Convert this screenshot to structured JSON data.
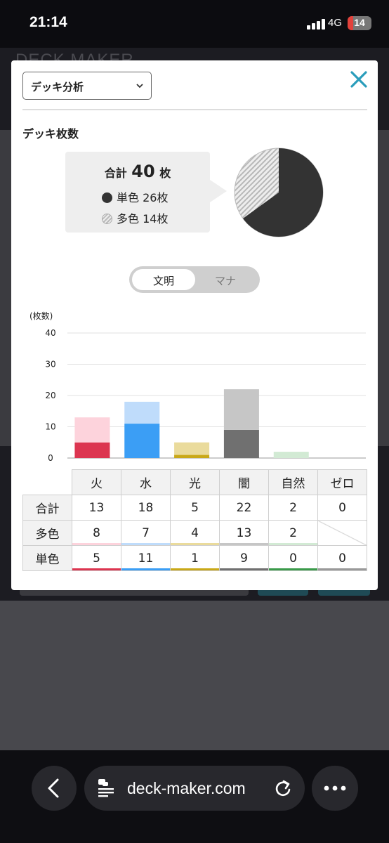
{
  "status": {
    "time": "21:14",
    "network": "4G",
    "battery": "14"
  },
  "background": {
    "app_logo": "DECK MAKER"
  },
  "modal": {
    "view_select": "デッキ分析",
    "section_title": "デッキ枚数",
    "summary": {
      "total_prefix": "合計",
      "total_value": "40",
      "total_unit": "枚",
      "mono_label": "単色 26枚",
      "multi_label": "多色 14枚",
      "mono_count": 26,
      "multi_count": 14,
      "mono_color": "#333333"
    },
    "toggle": {
      "active": "文明",
      "inactive": "マナ"
    },
    "table": {
      "columns": [
        "火",
        "水",
        "光",
        "闇",
        "自然",
        "ゼロ"
      ],
      "rows": [
        {
          "label": "合計",
          "values": [
            "13",
            "18",
            "5",
            "22",
            "2",
            "0"
          ]
        },
        {
          "label": "多色",
          "values": [
            "8",
            "7",
            "4",
            "13",
            "2",
            ""
          ]
        },
        {
          "label": "単色",
          "values": [
            "5",
            "11",
            "1",
            "9",
            "0",
            "0"
          ]
        }
      ]
    }
  },
  "chart_data": {
    "type": "bar",
    "stacked": true,
    "ylabel": "(枚数)",
    "ylim": [
      0,
      40
    ],
    "yticks": [
      "0",
      "10",
      "20",
      "30",
      "40"
    ],
    "grid": true,
    "categories": [
      "火",
      "水",
      "光",
      "闇",
      "自然",
      "ゼロ"
    ],
    "series": [
      {
        "values": [
          5,
          11,
          1,
          9,
          0,
          0
        ],
        "colors": [
          "#dc3550",
          "#3b9ef5",
          "#c9a818",
          "#707070",
          "#3a9a4a",
          "#999999"
        ]
      },
      {
        "values": [
          8,
          7,
          4,
          13,
          2,
          0
        ],
        "colors": [
          "#fdd3dc",
          "#bfdcfb",
          "#eadb9c",
          "#c6c6c6",
          "#d2ead4",
          "#dddddd"
        ]
      }
    ]
  },
  "browser": {
    "url": "deck-maker.com"
  }
}
